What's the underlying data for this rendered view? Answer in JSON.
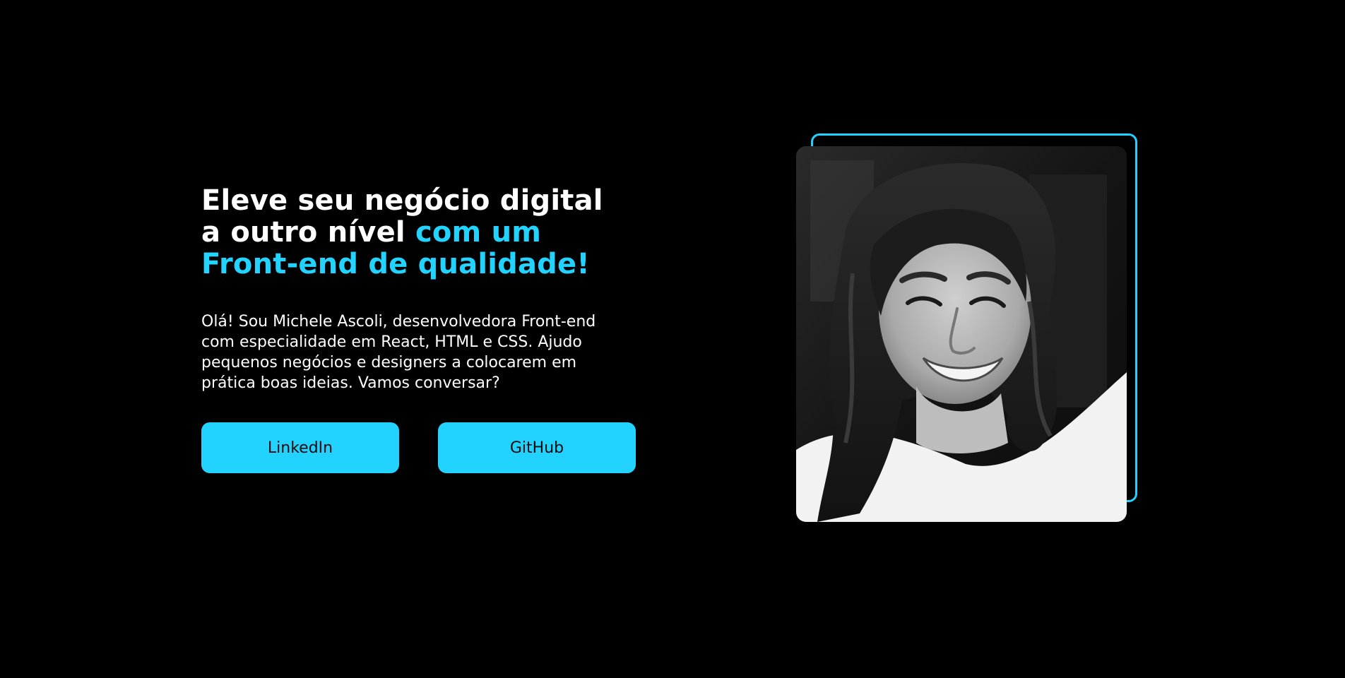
{
  "hero": {
    "headline": {
      "line1": "Eleve seu negócio digital",
      "line2_white": "a outro nível ",
      "line2_accent": "com um",
      "line3_accent": "Front-end de qualidade!"
    },
    "intro_lines": [
      "Olá! Sou Michele Ascoli, desenvolvedora Front-end",
      "com especialidade em React, HTML e CSS. Ajudo",
      "pequenos negócios e designers a colocarem em",
      "prática boas ideias. Vamos conversar?"
    ],
    "buttons": {
      "linkedin_label": "LinkedIn",
      "github_label": "GitHub"
    }
  },
  "photo": {
    "icon": "portrait-photo",
    "style": "black-and-white"
  },
  "colors": {
    "background": "#000000",
    "accent": "#22d3ff",
    "text": "#ffffff",
    "button_text": "#0a0a0a"
  }
}
